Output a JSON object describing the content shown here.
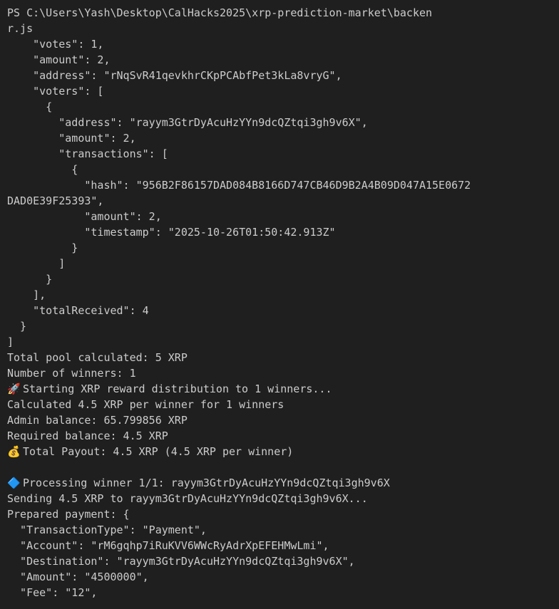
{
  "terminal": {
    "lines": [
      {
        "text": "PS C:\\Users\\Yash\\Desktop\\CalHacks2025\\xrp-prediction-market\\backen"
      },
      {
        "text": "r.js"
      },
      {
        "text": "    \"votes\": 1,"
      },
      {
        "text": "    \"amount\": 2,"
      },
      {
        "text": "    \"address\": \"rNqSvR41qevkhrCKpPCAbfPet3kLa8vryG\","
      },
      {
        "text": "    \"voters\": ["
      },
      {
        "text": "      {"
      },
      {
        "text": "        \"address\": \"rayym3GtrDyAcuHzYYn9dcQZtqi3gh9v6X\","
      },
      {
        "text": "        \"amount\": 2,"
      },
      {
        "text": "        \"transactions\": ["
      },
      {
        "text": "          {"
      },
      {
        "text": "            \"hash\": \"956B2F86157DAD084B8166D747CB46D9B2A4B09D047A15E0672"
      },
      {
        "text": "DAD0E39F25393\","
      },
      {
        "text": "            \"amount\": 2,"
      },
      {
        "text": "            \"timestamp\": \"2025-10-26T01:50:42.913Z\""
      },
      {
        "text": "          }"
      },
      {
        "text": "        ]"
      },
      {
        "text": "      }"
      },
      {
        "text": "    ],"
      },
      {
        "text": "    \"totalReceived\": 4"
      },
      {
        "text": "  }"
      },
      {
        "text": "]"
      },
      {
        "text": "Total pool calculated: 5 XRP"
      },
      {
        "text": "Number of winners: 1"
      },
      {
        "emoji": "🚀",
        "icon": "rocket-icon",
        "text": "Starting XRP reward distribution to 1 winners..."
      },
      {
        "text": "Calculated 4.5 XRP per winner for 1 winners"
      },
      {
        "text": "Admin balance: 65.799856 XRP"
      },
      {
        "text": "Required balance: 4.5 XRP"
      },
      {
        "emoji": "💰",
        "icon": "money-bag-icon",
        "text": "Total Payout: 4.5 XRP (4.5 XRP per winner)"
      },
      {
        "text": ""
      },
      {
        "emoji": "🔷",
        "icon": "blue-diamond-icon",
        "text": "Processing winner 1/1: rayym3GtrDyAcuHzYYn9dcQZtqi3gh9v6X"
      },
      {
        "text": "Sending 4.5 XRP to rayym3GtrDyAcuHzYYn9dcQZtqi3gh9v6X..."
      },
      {
        "text": "Prepared payment: {"
      },
      {
        "text": "  \"TransactionType\": \"Payment\","
      },
      {
        "text": "  \"Account\": \"rM6gqhp7iRuKVV6WWcRyAdrXpEFEHMwLmi\","
      },
      {
        "text": "  \"Destination\": \"rayym3GtrDyAcuHzYYn9dcQZtqi3gh9v6X\","
      },
      {
        "text": "  \"Amount\": \"4500000\","
      },
      {
        "text": "  \"Fee\": \"12\","
      }
    ]
  },
  "colors": {
    "background": "#1f1f1f",
    "foreground": "#cccccc"
  }
}
